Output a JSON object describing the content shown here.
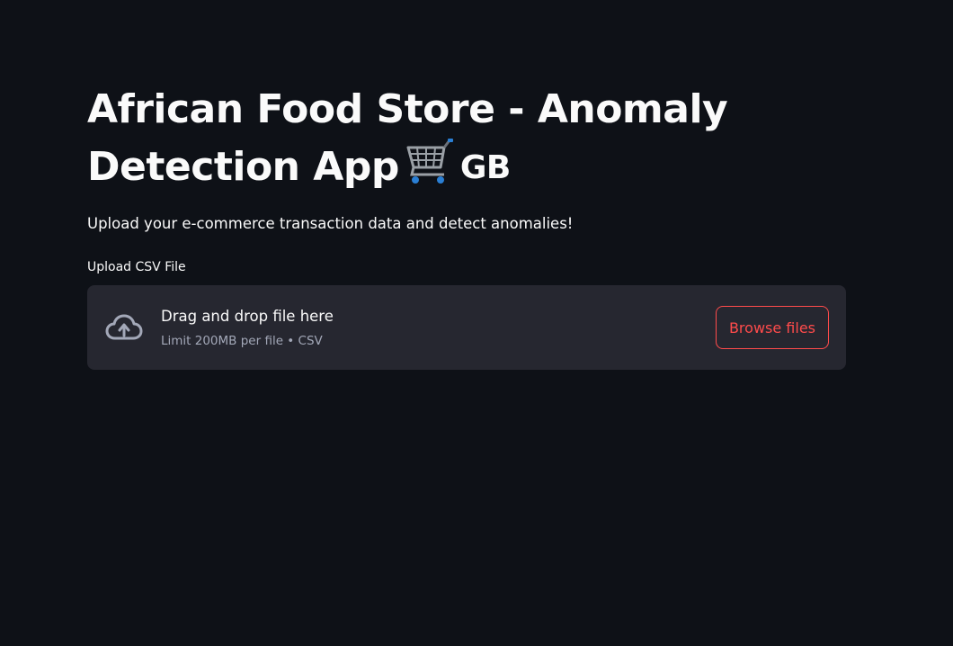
{
  "header": {
    "title": "African Food Store - Anomaly Detection App",
    "title_emoji_text": "GB",
    "cart_icon": "shopping-cart-icon"
  },
  "subtitle": "Upload your e-commerce transaction data and detect anomalies!",
  "uploader": {
    "label": "Upload CSV File",
    "icon": "cloud-upload-icon",
    "drop_title": "Drag and drop file here",
    "drop_subtitle": "Limit 200MB per file • CSV",
    "browse_label": "Browse files"
  },
  "colors": {
    "background": "#0e1117",
    "dropzone": "#262730",
    "accent": "#ff4b4b",
    "text": "#fafafa",
    "muted_text": "#a3a8b8"
  }
}
